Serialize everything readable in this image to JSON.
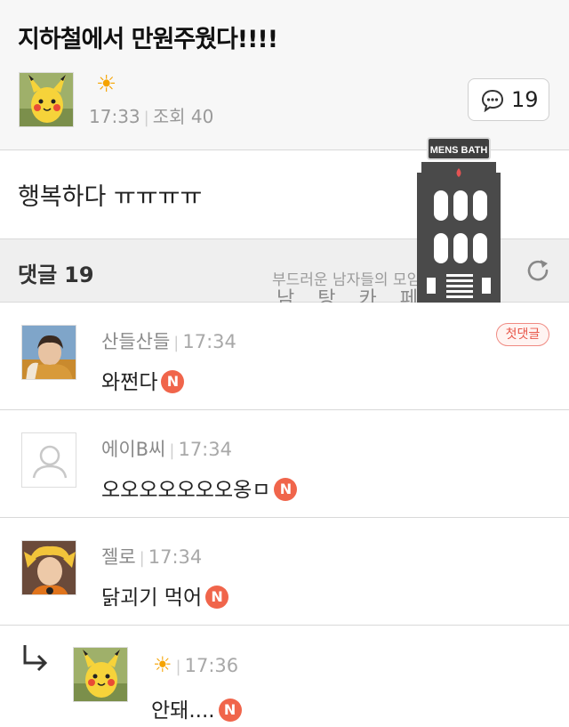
{
  "post": {
    "title": "지하철에서 만원주웠다!!!!",
    "author_icon": "sun-icon",
    "time": "17:33",
    "views_label": "조회 40",
    "comment_count": "19",
    "body": "행복하다 ㅠㅠㅠㅠ"
  },
  "comments_header": {
    "label": "댓글",
    "count": "19"
  },
  "watermark": {
    "sub": "부드러운 남자들의 모임",
    "main": "남탕카페",
    "sign": "MENS BATH"
  },
  "comments": [
    {
      "name": "산들산들",
      "time": "17:34",
      "text": "와쩐다",
      "badge": "N",
      "first_label": "첫댓글"
    },
    {
      "name": "에이B씨",
      "time": "17:34",
      "text": "오오오오오오오옹ㅁ",
      "badge": "N"
    },
    {
      "name": "젤로",
      "time": "17:34",
      "text": "닭괴기 먹어",
      "badge": "N"
    },
    {
      "name_icon": "sun-icon",
      "time": "17:36",
      "text": "안돼....",
      "badge": "N"
    }
  ],
  "colors": {
    "accent_new": "#f0654b",
    "first_badge": "#e8574a",
    "muted_text": "#9a9a9a"
  }
}
